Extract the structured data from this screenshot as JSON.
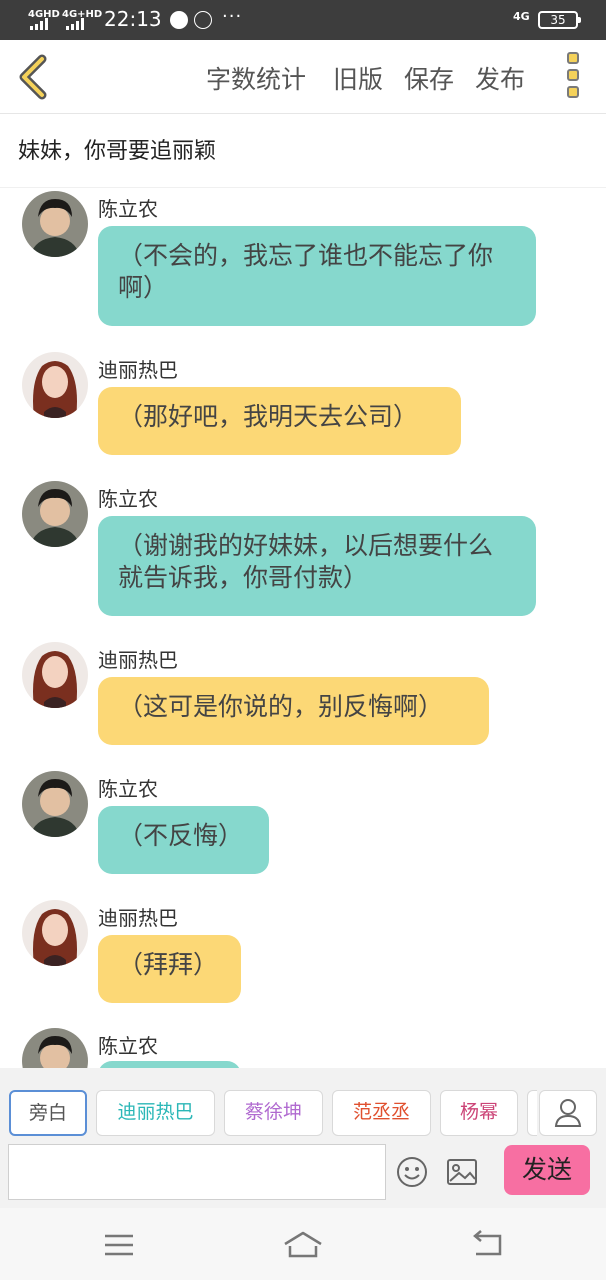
{
  "status_bar": {
    "signal_1": "4GHD",
    "signal_2": "4G+HD",
    "time": "22:13",
    "network": "4G",
    "battery": "35"
  },
  "toolbar": {
    "word_count": "字数统计",
    "old_version": "旧版",
    "save": "保存",
    "publish": "发布"
  },
  "story": {
    "title": "妹妹，你哥要追丽颖"
  },
  "messages": [
    {
      "speaker": "陈立农",
      "text": "（不会的，我忘了谁也不能忘了你啊）",
      "role": "male"
    },
    {
      "speaker": "迪丽热巴",
      "text": "（那好吧，我明天去公司）",
      "role": "female"
    },
    {
      "speaker": "陈立农",
      "text": "（谢谢我的好妹妹，以后想要什么就告诉我，你哥付款）",
      "role": "male"
    },
    {
      "speaker": "迪丽热巴",
      "text": "（这可是你说的，别反悔啊）",
      "role": "female"
    },
    {
      "speaker": "陈立农",
      "text": "（不反悔）",
      "role": "male"
    },
    {
      "speaker": "迪丽热巴",
      "text": "（拜拜）",
      "role": "female"
    },
    {
      "speaker": "陈立农",
      "text": "",
      "role": "male"
    }
  ],
  "cast": {
    "chips": [
      {
        "label": "旁白",
        "color": "#555555"
      },
      {
        "label": "迪丽热巴",
        "color": "#2bb7b7"
      },
      {
        "label": "蔡徐坤",
        "color": "#b06ad0"
      },
      {
        "label": "范丞丞",
        "color": "#e0502f"
      },
      {
        "label": "杨幂",
        "color": "#cc4477"
      }
    ],
    "send": "发送"
  },
  "colors": {
    "teal_bubble": "#86d8cd",
    "yellow_bubble": "#fcd876",
    "send_button": "#f76fa2",
    "accent": "#f5d25a"
  },
  "icons": {
    "back": "chevron-left-icon",
    "more": "more-vertical-icon",
    "person": "person-icon",
    "emoji": "smiley-icon",
    "image": "image-icon",
    "menu": "menu-icon",
    "home": "home-icon",
    "return": "back-icon"
  }
}
